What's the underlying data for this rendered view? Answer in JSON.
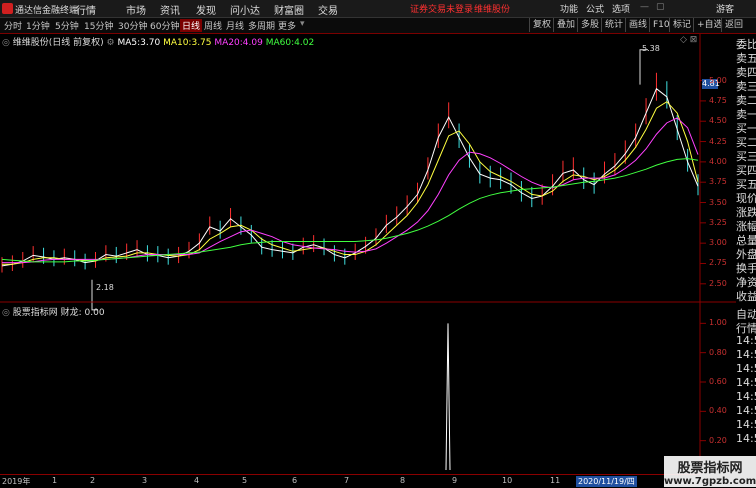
{
  "titlebar": {
    "app_name": "通达信金融终端",
    "menus": [
      "行情",
      "市场",
      "资讯",
      "发现",
      "问小达",
      "财富圈",
      "交易"
    ],
    "warning": "证券交易未登录",
    "stock_link": "维维股份",
    "right_items": [
      "功能",
      "公式",
      "选项"
    ],
    "user": "游客"
  },
  "toolbar": {
    "periods": [
      "分时",
      "1分钟",
      "5分钟",
      "15分钟",
      "30分钟",
      "60分钟",
      "日线",
      "周线",
      "月线",
      "多周期",
      "更多"
    ],
    "active_period": "日线",
    "buttons": [
      "复权",
      "叠加",
      "多股",
      "统计",
      "画线",
      "F10",
      "标记",
      "+自选",
      "返回"
    ]
  },
  "main_chart": {
    "stock": "维维股份(日线 前复权)",
    "ma": [
      {
        "label": "MA5:",
        "value": "3.70",
        "color": "#ffffff"
      },
      {
        "label": "MA10:",
        "value": "3.75",
        "color": "#ffff40"
      },
      {
        "label": "MA20:",
        "value": "4.09",
        "color": "#ff40ff"
      },
      {
        "label": "MA60:",
        "value": "4.02",
        "color": "#40ff40"
      }
    ],
    "high_label": "5.38",
    "low_label": "2.18",
    "current_price": "4.81"
  },
  "sub_chart": {
    "title": "股票指标网",
    "indicator_label": "财龙:",
    "indicator_value": "0.00"
  },
  "right_panel": {
    "labels": [
      "委比",
      "卖五",
      "卖四",
      "卖三",
      "卖二",
      "卖一",
      "买一",
      "买二",
      "买三",
      "买四",
      "买五",
      "现价",
      "涨跌",
      "涨幅",
      "总量",
      "外盘",
      "换手",
      "净资",
      "收益",
      "自动",
      "行情",
      "14:5",
      "14:5",
      "14:5",
      "14:5",
      "14:5",
      "14:5",
      "14:5",
      "14:5"
    ]
  },
  "x_axis": {
    "labels": [
      "2019年",
      "1",
      "2",
      "3",
      "4",
      "5",
      "6",
      "7",
      "8",
      "9",
      "10",
      "11"
    ],
    "cursor_date": "2020/11/19/四"
  },
  "watermark": {
    "line1": "股票指标网",
    "line2": "www.7gpzb.com"
  },
  "chart_data": [
    {
      "type": "candlestick",
      "title": "维维股份(日线 前复权)",
      "y_ticks": [
        "5.00",
        "4.75",
        "4.50",
        "4.25",
        "4.00",
        "3.75",
        "3.50",
        "3.25",
        "3.00",
        "2.75",
        "2.50"
      ],
      "ylim": [
        2.35,
        5.45
      ],
      "x_ticks": [
        "2019年",
        "1",
        "2",
        "3",
        "4",
        "5",
        "6",
        "7",
        "8",
        "9",
        "10",
        "11"
      ],
      "annotations": [
        "5.38",
        "2.18"
      ],
      "series": [
        {
          "name": "MA5",
          "color": "#ffffff",
          "values": [
            2.72,
            2.74,
            2.78,
            2.85,
            2.83,
            2.8,
            2.82,
            2.8,
            2.76,
            2.78,
            2.86,
            2.84,
            2.88,
            2.92,
            2.86,
            2.85,
            2.82,
            2.84,
            2.9,
            3.0,
            3.2,
            3.15,
            3.3,
            3.2,
            3.1,
            2.95,
            2.92,
            2.9,
            2.88,
            2.95,
            2.98,
            2.94,
            2.86,
            2.82,
            2.88,
            2.96,
            3.06,
            3.22,
            3.32,
            3.45,
            3.6,
            3.9,
            4.3,
            4.55,
            4.3,
            4.05,
            3.85,
            3.8,
            3.78,
            3.72,
            3.62,
            3.55,
            3.58,
            3.7,
            3.86,
            3.9,
            3.78,
            3.72,
            3.85,
            3.95,
            4.1,
            4.3,
            4.6,
            4.9,
            4.8,
            4.4,
            4.0,
            3.7
          ]
        },
        {
          "name": "MA10",
          "color": "#ffff40",
          "values": [
            2.74,
            2.74,
            2.76,
            2.8,
            2.82,
            2.82,
            2.8,
            2.8,
            2.79,
            2.78,
            2.82,
            2.83,
            2.84,
            2.88,
            2.88,
            2.86,
            2.85,
            2.84,
            2.86,
            2.92,
            3.05,
            3.12,
            3.2,
            3.22,
            3.16,
            3.05,
            2.98,
            2.94,
            2.9,
            2.92,
            2.94,
            2.94,
            2.9,
            2.86,
            2.86,
            2.9,
            2.98,
            3.1,
            3.22,
            3.34,
            3.5,
            3.72,
            4.02,
            4.32,
            4.38,
            4.22,
            4.0,
            3.88,
            3.82,
            3.76,
            3.68,
            3.6,
            3.58,
            3.64,
            3.76,
            3.84,
            3.82,
            3.78,
            3.82,
            3.9,
            4.02,
            4.18,
            4.4,
            4.66,
            4.74,
            4.6,
            4.25,
            3.75
          ]
        },
        {
          "name": "MA20",
          "color": "#ff40ff",
          "values": [
            2.76,
            2.76,
            2.76,
            2.77,
            2.79,
            2.8,
            2.8,
            2.8,
            2.8,
            2.8,
            2.8,
            2.81,
            2.82,
            2.84,
            2.86,
            2.86,
            2.86,
            2.86,
            2.86,
            2.88,
            2.95,
            3.02,
            3.08,
            3.14,
            3.16,
            3.12,
            3.08,
            3.02,
            2.98,
            2.96,
            2.94,
            2.93,
            2.92,
            2.9,
            2.89,
            2.9,
            2.93,
            3.0,
            3.08,
            3.16,
            3.26,
            3.4,
            3.6,
            3.84,
            4.02,
            4.12,
            4.1,
            4.05,
            3.98,
            3.9,
            3.82,
            3.75,
            3.7,
            3.68,
            3.72,
            3.78,
            3.8,
            3.8,
            3.8,
            3.84,
            3.92,
            4.02,
            4.16,
            4.34,
            4.48,
            4.54,
            4.42,
            4.09
          ]
        },
        {
          "name": "MA60",
          "color": "#40ff40",
          "values": [
            2.8,
            2.79,
            2.78,
            2.77,
            2.77,
            2.77,
            2.77,
            2.78,
            2.78,
            2.79,
            2.8,
            2.81,
            2.82,
            2.83,
            2.84,
            2.85,
            2.86,
            2.87,
            2.88,
            2.89,
            2.91,
            2.93,
            2.95,
            2.98,
            3.0,
            3.01,
            3.02,
            3.02,
            3.02,
            3.02,
            3.02,
            3.02,
            3.02,
            3.02,
            3.02,
            3.03,
            3.04,
            3.06,
            3.09,
            3.12,
            3.16,
            3.21,
            3.27,
            3.34,
            3.42,
            3.49,
            3.55,
            3.59,
            3.62,
            3.64,
            3.66,
            3.67,
            3.68,
            3.69,
            3.71,
            3.73,
            3.75,
            3.76,
            3.78,
            3.8,
            3.83,
            3.87,
            3.91,
            3.96,
            4.0,
            4.03,
            4.04,
            4.02
          ]
        }
      ]
    },
    {
      "type": "line",
      "title": "股票指标网",
      "y_ticks": [
        "1.00",
        "0.80",
        "0.60",
        "0.40",
        "0.20"
      ],
      "ylim": [
        0,
        1.05
      ],
      "series": [
        {
          "name": "财龙",
          "color": "#ffffff",
          "spike_x_fraction": 0.64,
          "values_note_free": [
            0,
            1,
            0
          ]
        }
      ]
    }
  ]
}
